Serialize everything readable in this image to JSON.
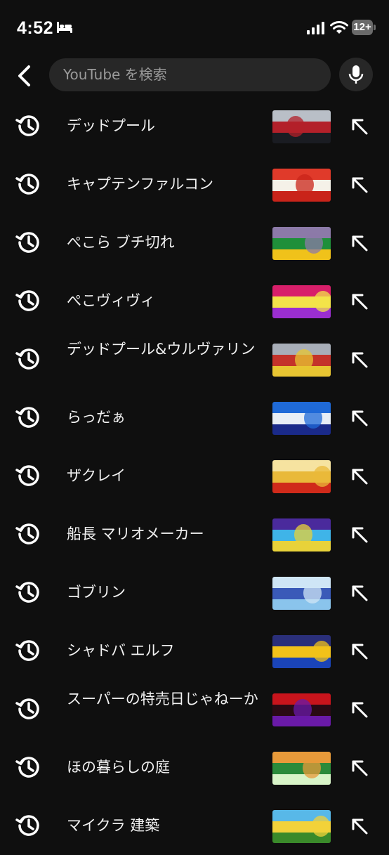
{
  "status": {
    "time": "4:52",
    "battery": "12+",
    "icons": [
      "bed-icon",
      "cellular-signal-icon",
      "wifi-icon",
      "battery-icon"
    ]
  },
  "header": {
    "back_icon": "chevron-left-icon",
    "search_placeholder": "YouTube を検索",
    "mic_icon": "microphone-icon"
  },
  "suggestions": [
    {
      "text": "デッドプール",
      "icon": "history-icon",
      "thumb_colors": [
        "#b9bfc7",
        "#b3202a",
        "#1a1c22"
      ]
    },
    {
      "text": "キャプテンファルコン",
      "icon": "history-icon",
      "thumb_colors": [
        "#e03a2a",
        "#f5f1e8",
        "#c9241a"
      ]
    },
    {
      "text": "ぺこら ブチ切れ",
      "icon": "history-icon",
      "thumb_colors": [
        "#8c7aa8",
        "#1f8f3a",
        "#f0c21a"
      ]
    },
    {
      "text": "ぺこヴィヴィ",
      "icon": "history-icon",
      "thumb_colors": [
        "#d81f6a",
        "#f3e34a",
        "#9b2ed0"
      ]
    },
    {
      "text": "デッドプール&ウルヴァリン",
      "icon": "history-icon",
      "thumb_colors": [
        "#a8aeb8",
        "#c4322a",
        "#e8c532"
      ]
    },
    {
      "text": "らっだぁ",
      "icon": "history-icon",
      "thumb_colors": [
        "#1f6ad8",
        "#e8eef6",
        "#1a2a8a"
      ]
    },
    {
      "text": "ザクレイ",
      "icon": "history-icon",
      "thumb_colors": [
        "#f6e3a0",
        "#e9b93a",
        "#d02a1a"
      ]
    },
    {
      "text": "船長 マリオメーカー",
      "icon": "history-icon",
      "thumb_colors": [
        "#4a2a9c",
        "#3fb4e8",
        "#e8d23a"
      ]
    },
    {
      "text": "ゴブリン",
      "icon": "history-icon",
      "thumb_colors": [
        "#cfe6f6",
        "#3a5ab8",
        "#8ac4ec"
      ]
    },
    {
      "text": "シャドバ エルフ",
      "icon": "history-icon",
      "thumb_colors": [
        "#2a2f7a",
        "#f2c21a",
        "#1a44b8"
      ]
    },
    {
      "text": "スーパーの特売日じゃねーか",
      "icon": "history-icon",
      "thumb_colors": [
        "#c8141c",
        "#2a0a14",
        "#6a1aa8"
      ]
    },
    {
      "text": "ほの暮らしの庭",
      "icon": "history-icon",
      "thumb_colors": [
        "#e89a3a",
        "#2a8a3a",
        "#d8f4c8"
      ]
    },
    {
      "text": "マイクラ 建築",
      "icon": "history-icon",
      "thumb_colors": [
        "#58b8e8",
        "#f2d23a",
        "#3a8a2a"
      ]
    }
  ],
  "row_action_icon": "fill-query-arrow-icon"
}
